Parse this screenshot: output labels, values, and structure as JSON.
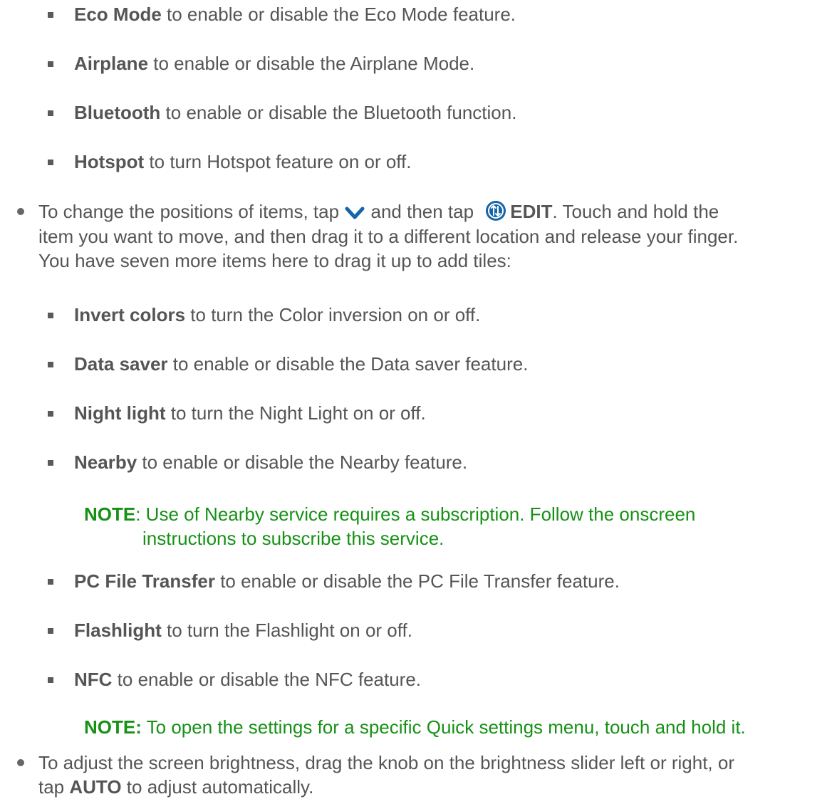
{
  "list1": [
    {
      "term": "Eco Mode",
      "text": " to enable or disable the Eco Mode feature."
    },
    {
      "term": "Airplane",
      "text": " to enable or disable the Airplane Mode."
    },
    {
      "term": "Bluetooth",
      "text": " to enable or disable the Bluetooth function."
    },
    {
      "term": "Hotspot",
      "text": " to turn Hotspot feature on or off."
    }
  ],
  "bullet_positions": {
    "part1": "To change the positions of items, tap ",
    "chevron_icon": "chevron-down-icon",
    "part2": " and then tap ",
    "edit_icon": "edit-arrows-icon",
    "edit_label": "EDIT",
    "part3": ". Touch and hold the",
    "line2": "item you want to move, and then drag it to a different location and release your finger.",
    "line3": "You have seven more items here to drag it up to add tiles:"
  },
  "list2": [
    {
      "term": "Invert colors",
      "text": " to turn the Color inversion on or off."
    },
    {
      "term": "Data saver",
      "text": " to enable or disable the Data saver feature."
    },
    {
      "term": "Night light",
      "text": " to turn the Night Light on or off."
    },
    {
      "term": "Nearby",
      "text": " to enable or disable the Nearby feature."
    }
  ],
  "note1": {
    "label": "NOTE",
    "text1": ": Use of Nearby service requires a subscription. Follow the onscreen",
    "text2": "instructions to subscribe this service."
  },
  "list3": [
    {
      "term": "PC File Transfer",
      "text": " to enable or disable the PC File Transfer feature."
    },
    {
      "term": "Flashlight",
      "text": " to turn the Flashlight on or off."
    },
    {
      "term": "NFC",
      "text": " to enable or disable the NFC feature."
    }
  ],
  "note2": {
    "label": "NOTE:",
    "text": " To open the settings for a specific Quick settings menu, touch and hold it."
  },
  "bullet_brightness": {
    "part1": "To adjust the screen brightness, drag the knob on the brightness slider left or right, or",
    "line2_pre": "tap ",
    "auto_label": "AUTO",
    "line2_post": " to adjust automatically."
  },
  "colors": {
    "text": "#555555",
    "note": "#169115",
    "icon_blue": "#1565a8"
  }
}
